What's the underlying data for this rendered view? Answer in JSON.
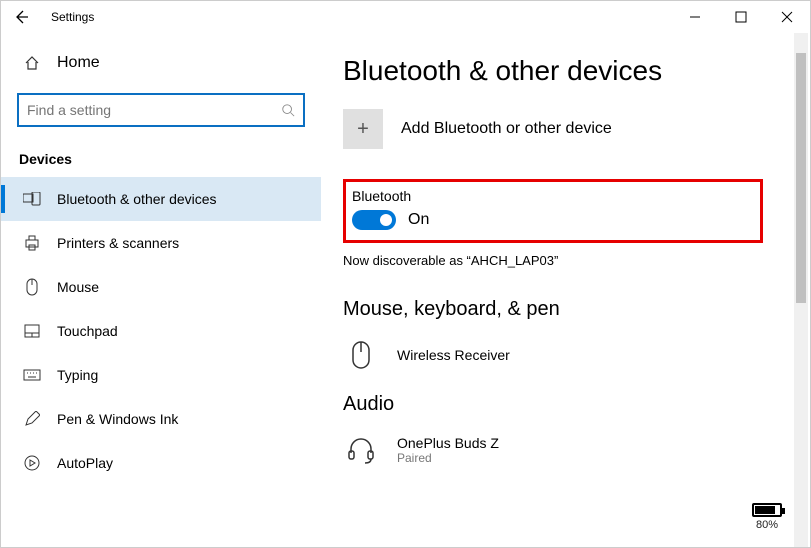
{
  "titlebar": {
    "title": "Settings"
  },
  "sidebar": {
    "home_label": "Home",
    "search_placeholder": "Find a setting",
    "category": "Devices",
    "items": [
      {
        "label": "Bluetooth & other devices",
        "selected": true
      },
      {
        "label": "Printers & scanners"
      },
      {
        "label": "Mouse"
      },
      {
        "label": "Touchpad"
      },
      {
        "label": "Typing"
      },
      {
        "label": "Pen & Windows Ink"
      },
      {
        "label": "AutoPlay"
      }
    ]
  },
  "main": {
    "title": "Bluetooth & other devices",
    "add_label": "Add Bluetooth or other device",
    "bt_section_label": "Bluetooth",
    "bt_state_label": "On",
    "discover_text": "Now discoverable as “AHCH_LAP03”",
    "section_mkp": "Mouse, keyboard, & pen",
    "device_mouse": {
      "name": "Wireless Receiver"
    },
    "section_audio": "Audio",
    "device_audio": {
      "name": "OnePlus Buds Z",
      "status": "Paired",
      "battery": "80%"
    }
  }
}
